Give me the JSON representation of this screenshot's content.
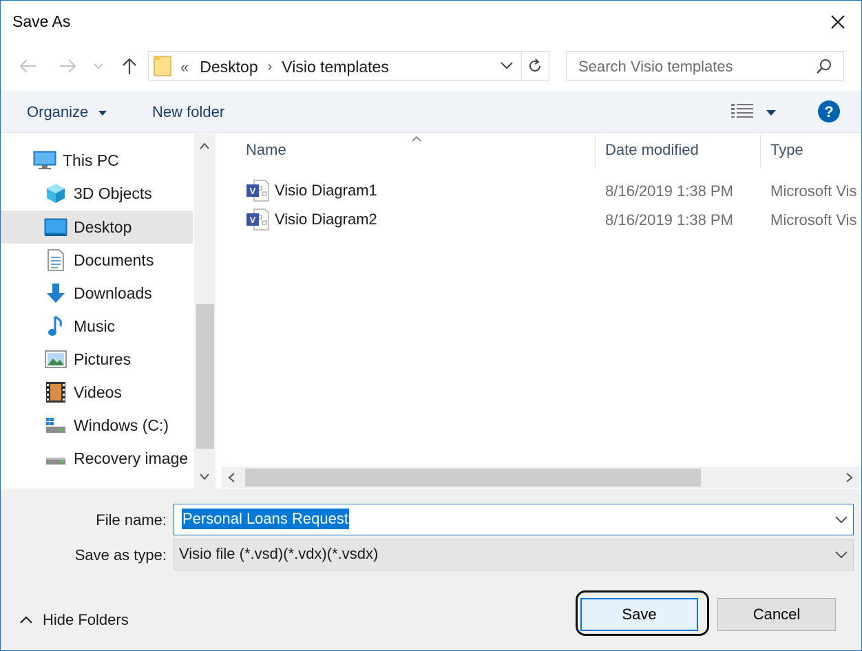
{
  "window": {
    "title": "Save As"
  },
  "address": {
    "lead": "«",
    "crumbs": [
      "Desktop",
      "Visio templates"
    ]
  },
  "search": {
    "placeholder": "Search Visio templates"
  },
  "toolbar": {
    "organize": "Organize",
    "new_folder": "New folder"
  },
  "nav": {
    "items": [
      {
        "label": "This PC",
        "icon": "computer-icon"
      },
      {
        "label": "3D Objects",
        "icon": "cube-icon"
      },
      {
        "label": "Desktop",
        "icon": "desktop-icon",
        "selected": true
      },
      {
        "label": "Documents",
        "icon": "document-icon"
      },
      {
        "label": "Downloads",
        "icon": "download-arrow-icon"
      },
      {
        "label": "Music",
        "icon": "music-note-icon"
      },
      {
        "label": "Pictures",
        "icon": "picture-icon"
      },
      {
        "label": "Videos",
        "icon": "film-icon"
      },
      {
        "label": "Windows (C:)",
        "icon": "drive-icon"
      },
      {
        "label": "Recovery image",
        "icon": "drive-icon"
      }
    ]
  },
  "files": {
    "columns": {
      "name": "Name",
      "date": "Date modified",
      "type": "Type"
    },
    "rows": [
      {
        "name": "Visio Diagram1",
        "date": "8/16/2019 1:38 PM",
        "type": "Microsoft Vis"
      },
      {
        "name": "Visio Diagram2",
        "date": "8/16/2019 1:38 PM",
        "type": "Microsoft Vis"
      }
    ]
  },
  "form": {
    "file_name_label": "File name:",
    "file_name_value": "Personal Loans Request",
    "save_type_label": "Save as type:",
    "save_type_value": "Visio file (*.vsd)(*.vdx)(*.vsdx)"
  },
  "footer": {
    "hide_folders": "Hide Folders",
    "save": "Save",
    "cancel": "Cancel"
  },
  "colors": {
    "accent": "#0078d7",
    "selection": "#0078d7",
    "toolbar_bg": "#f0f4f9",
    "help": "#0063b1"
  }
}
